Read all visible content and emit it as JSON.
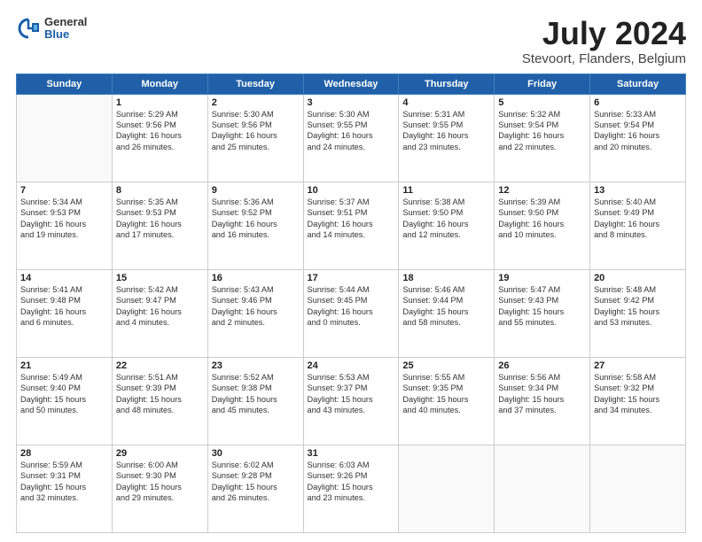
{
  "header": {
    "logo_general": "General",
    "logo_blue": "Blue",
    "main_title": "July 2024",
    "subtitle": "Stevoort, Flanders, Belgium"
  },
  "calendar": {
    "days_of_week": [
      "Sunday",
      "Monday",
      "Tuesday",
      "Wednesday",
      "Thursday",
      "Friday",
      "Saturday"
    ],
    "weeks": [
      [
        {
          "day": "",
          "info": ""
        },
        {
          "day": "1",
          "info": "Sunrise: 5:29 AM\nSunset: 9:56 PM\nDaylight: 16 hours\nand 26 minutes."
        },
        {
          "day": "2",
          "info": "Sunrise: 5:30 AM\nSunset: 9:56 PM\nDaylight: 16 hours\nand 25 minutes."
        },
        {
          "day": "3",
          "info": "Sunrise: 5:30 AM\nSunset: 9:55 PM\nDaylight: 16 hours\nand 24 minutes."
        },
        {
          "day": "4",
          "info": "Sunrise: 5:31 AM\nSunset: 9:55 PM\nDaylight: 16 hours\nand 23 minutes."
        },
        {
          "day": "5",
          "info": "Sunrise: 5:32 AM\nSunset: 9:54 PM\nDaylight: 16 hours\nand 22 minutes."
        },
        {
          "day": "6",
          "info": "Sunrise: 5:33 AM\nSunset: 9:54 PM\nDaylight: 16 hours\nand 20 minutes."
        }
      ],
      [
        {
          "day": "7",
          "info": "Sunrise: 5:34 AM\nSunset: 9:53 PM\nDaylight: 16 hours\nand 19 minutes."
        },
        {
          "day": "8",
          "info": "Sunrise: 5:35 AM\nSunset: 9:53 PM\nDaylight: 16 hours\nand 17 minutes."
        },
        {
          "day": "9",
          "info": "Sunrise: 5:36 AM\nSunset: 9:52 PM\nDaylight: 16 hours\nand 16 minutes."
        },
        {
          "day": "10",
          "info": "Sunrise: 5:37 AM\nSunset: 9:51 PM\nDaylight: 16 hours\nand 14 minutes."
        },
        {
          "day": "11",
          "info": "Sunrise: 5:38 AM\nSunset: 9:50 PM\nDaylight: 16 hours\nand 12 minutes."
        },
        {
          "day": "12",
          "info": "Sunrise: 5:39 AM\nSunset: 9:50 PM\nDaylight: 16 hours\nand 10 minutes."
        },
        {
          "day": "13",
          "info": "Sunrise: 5:40 AM\nSunset: 9:49 PM\nDaylight: 16 hours\nand 8 minutes."
        }
      ],
      [
        {
          "day": "14",
          "info": "Sunrise: 5:41 AM\nSunset: 9:48 PM\nDaylight: 16 hours\nand 6 minutes."
        },
        {
          "day": "15",
          "info": "Sunrise: 5:42 AM\nSunset: 9:47 PM\nDaylight: 16 hours\nand 4 minutes."
        },
        {
          "day": "16",
          "info": "Sunrise: 5:43 AM\nSunset: 9:46 PM\nDaylight: 16 hours\nand 2 minutes."
        },
        {
          "day": "17",
          "info": "Sunrise: 5:44 AM\nSunset: 9:45 PM\nDaylight: 16 hours\nand 0 minutes."
        },
        {
          "day": "18",
          "info": "Sunrise: 5:46 AM\nSunset: 9:44 PM\nDaylight: 15 hours\nand 58 minutes."
        },
        {
          "day": "19",
          "info": "Sunrise: 5:47 AM\nSunset: 9:43 PM\nDaylight: 15 hours\nand 55 minutes."
        },
        {
          "day": "20",
          "info": "Sunrise: 5:48 AM\nSunset: 9:42 PM\nDaylight: 15 hours\nand 53 minutes."
        }
      ],
      [
        {
          "day": "21",
          "info": "Sunrise: 5:49 AM\nSunset: 9:40 PM\nDaylight: 15 hours\nand 50 minutes."
        },
        {
          "day": "22",
          "info": "Sunrise: 5:51 AM\nSunset: 9:39 PM\nDaylight: 15 hours\nand 48 minutes."
        },
        {
          "day": "23",
          "info": "Sunrise: 5:52 AM\nSunset: 9:38 PM\nDaylight: 15 hours\nand 45 minutes."
        },
        {
          "day": "24",
          "info": "Sunrise: 5:53 AM\nSunset: 9:37 PM\nDaylight: 15 hours\nand 43 minutes."
        },
        {
          "day": "25",
          "info": "Sunrise: 5:55 AM\nSunset: 9:35 PM\nDaylight: 15 hours\nand 40 minutes."
        },
        {
          "day": "26",
          "info": "Sunrise: 5:56 AM\nSunset: 9:34 PM\nDaylight: 15 hours\nand 37 minutes."
        },
        {
          "day": "27",
          "info": "Sunrise: 5:58 AM\nSunset: 9:32 PM\nDaylight: 15 hours\nand 34 minutes."
        }
      ],
      [
        {
          "day": "28",
          "info": "Sunrise: 5:59 AM\nSunset: 9:31 PM\nDaylight: 15 hours\nand 32 minutes."
        },
        {
          "day": "29",
          "info": "Sunrise: 6:00 AM\nSunset: 9:30 PM\nDaylight: 15 hours\nand 29 minutes."
        },
        {
          "day": "30",
          "info": "Sunrise: 6:02 AM\nSunset: 9:28 PM\nDaylight: 15 hours\nand 26 minutes."
        },
        {
          "day": "31",
          "info": "Sunrise: 6:03 AM\nSunset: 9:26 PM\nDaylight: 15 hours\nand 23 minutes."
        },
        {
          "day": "",
          "info": ""
        },
        {
          "day": "",
          "info": ""
        },
        {
          "day": "",
          "info": ""
        }
      ]
    ]
  }
}
